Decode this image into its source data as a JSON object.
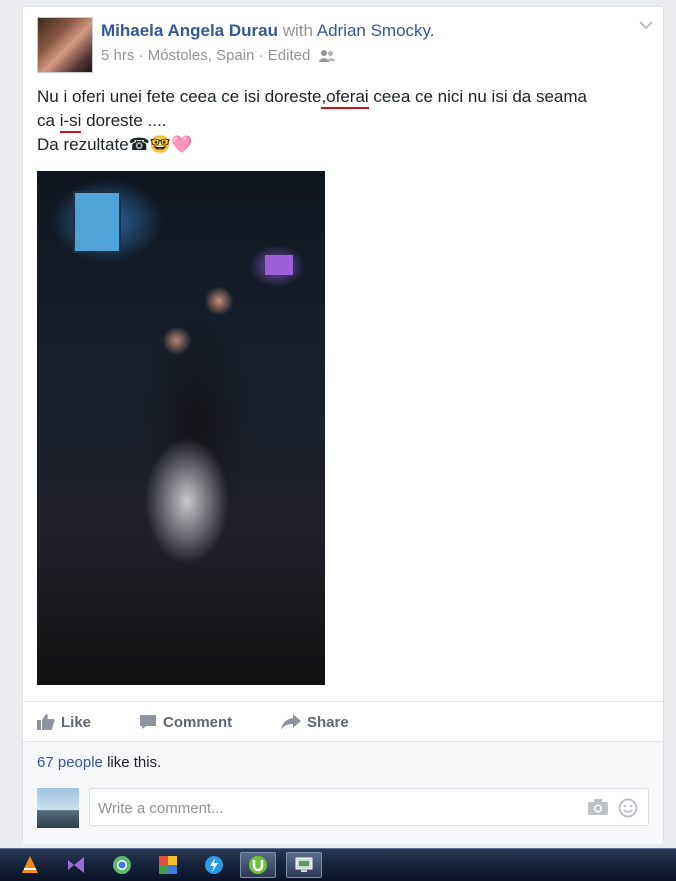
{
  "post": {
    "author_name": "Mihaela Angela Durau",
    "with_label": "with",
    "tagged_name": "Adrian Smocky.",
    "time": "5 hrs",
    "location": "Móstoles, Spain",
    "edited": "Edited",
    "privacy_icon": "friends-icon",
    "text_part1": "Nu i oferi unei fete ceea ce isi doreste",
    "text_part2": ",oferai",
    "text_part3": " ceea ce nici nu isi da seama",
    "text_part4": "ca ",
    "text_part5": "i-si",
    "text_part6": " doreste ....",
    "text_part7": "Da rezultate",
    "text_emojis": "☎🤓🩷"
  },
  "actions": {
    "like": "Like",
    "comment": "Comment",
    "share": "Share"
  },
  "likes": {
    "count": "67 people",
    "suffix": " like this."
  },
  "comment_box": {
    "placeholder": "Write a comment..."
  },
  "colors": {
    "link": "#365899",
    "secondary": "#90949c",
    "spell_underline": "#c9121b"
  },
  "taskbar": {
    "icons": [
      "vlc-icon",
      "visual-studio-icon",
      "chrome-icon",
      "picasa-icon",
      "skype-icon",
      "utorrent-icon",
      "desktop-app-icon"
    ]
  }
}
